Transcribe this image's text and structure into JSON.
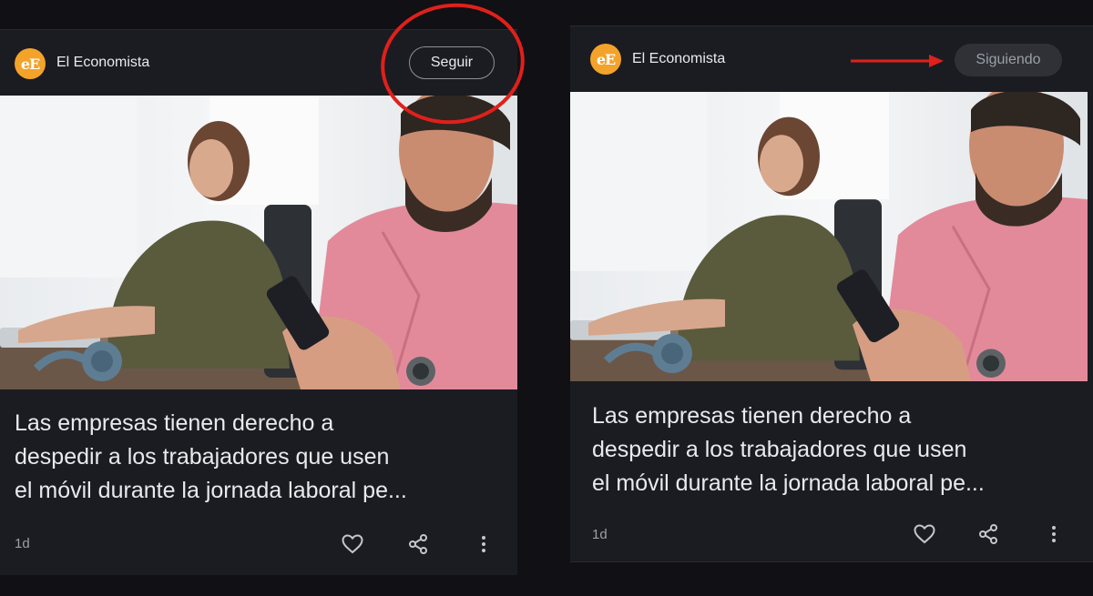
{
  "panels": [
    {
      "source_name": "El Economista",
      "logo_text": "eE",
      "follow_label": "Seguir",
      "headline": "Las empresas tienen derecho a\ndespedir a los trabajadores que usen\nel móvil durante la jornada laboral pe...",
      "age": "1d"
    },
    {
      "source_name": "El Economista",
      "logo_text": "eE",
      "follow_label": "Siguiendo",
      "headline": "Las empresas tienen derecho a\ndespedir a los trabajadores que usen\nel móvil durante la jornada laboral pe...",
      "age": "1d"
    }
  ],
  "icons": {
    "like": "heart-icon",
    "share": "share-icon",
    "more": "more-vertical-icon"
  },
  "colors": {
    "background": "#101015",
    "card": "#1b1c22",
    "logo": "#f4a32a",
    "annotation_red": "#e0201b"
  }
}
